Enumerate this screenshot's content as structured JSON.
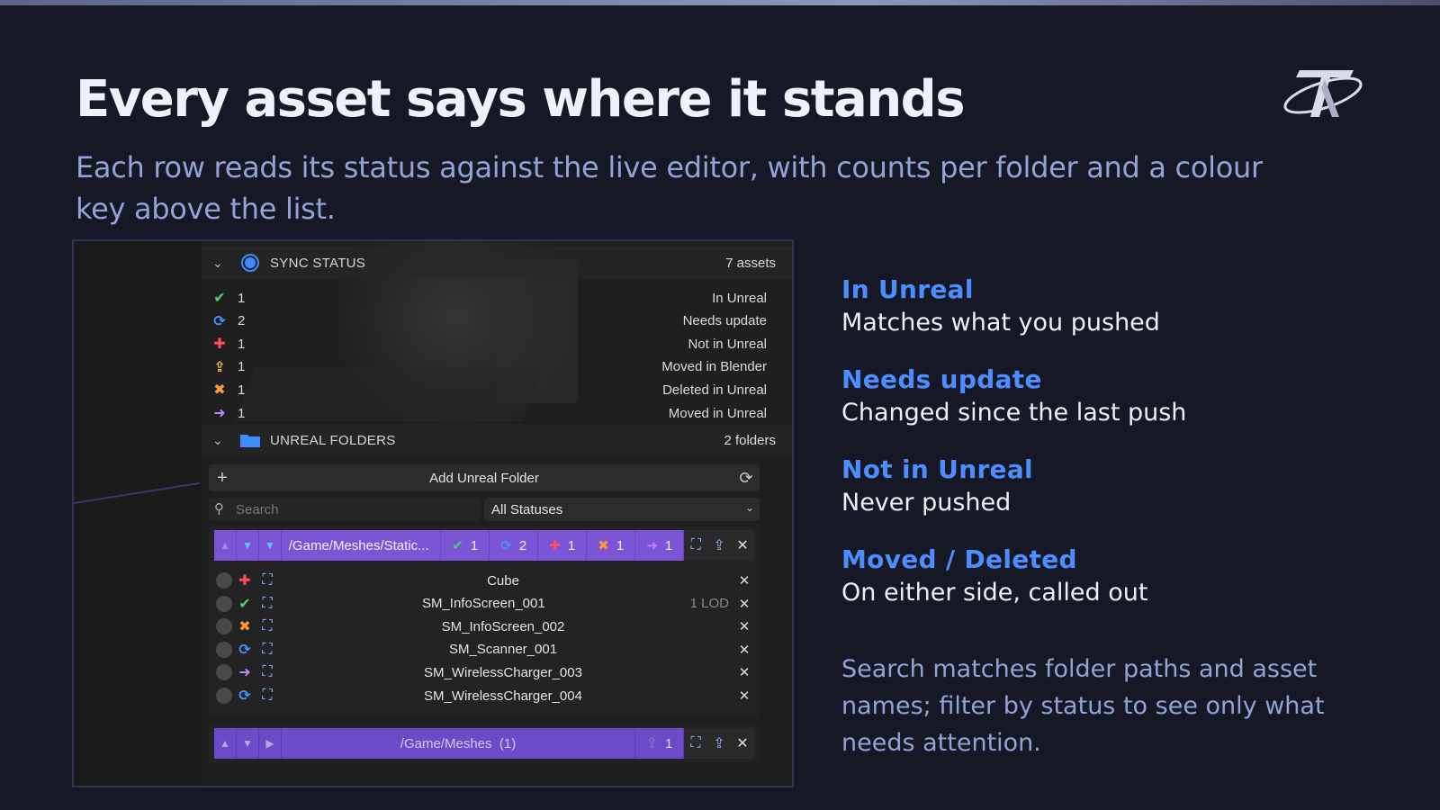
{
  "slide": {
    "title": "Every asset says where it stands",
    "subtitle": "Each row reads its status against the live editor, with counts per folder and a colour key above the list."
  },
  "panel": {
    "sync_status": {
      "label": "SYNC STATUS",
      "count": "7 assets",
      "rows": [
        {
          "icon": "check-icon",
          "glyph": "✔",
          "color": "#4bd36a",
          "count": "1",
          "label": "In Unreal"
        },
        {
          "icon": "refresh-icon",
          "glyph": "⟳",
          "color": "#4a90ff",
          "count": "2",
          "label": "Needs update"
        },
        {
          "icon": "plus-icon",
          "glyph": "✚",
          "color": "#ff4f5e",
          "count": "1",
          "label": "Not in Unreal"
        },
        {
          "icon": "upload-icon",
          "glyph": "⇪",
          "color": "#f1c24b",
          "count": "1",
          "label": "Moved in Blender"
        },
        {
          "icon": "cross-icon",
          "glyph": "✖",
          "color": "#ff9a2e",
          "count": "1",
          "label": "Deleted in Unreal"
        },
        {
          "icon": "arrow-right-icon",
          "glyph": "➜",
          "color": "#c084ff",
          "count": "1",
          "label": "Moved in Unreal"
        }
      ]
    },
    "unreal_folders": {
      "label": "UNREAL FOLDERS",
      "count": "2 folders",
      "add_label": "Add Unreal Folder",
      "search_placeholder": "Search",
      "status_filter": "All Statuses",
      "folder1": {
        "path": "/Game/Meshes/Static...",
        "badges": [
          {
            "glyph": "✔",
            "color": "#4bd36a",
            "count": "1"
          },
          {
            "glyph": "⟳",
            "color": "#4a90ff",
            "count": "2"
          },
          {
            "glyph": "✚",
            "color": "#ff4f5e",
            "count": "1"
          },
          {
            "glyph": "✖",
            "color": "#ff9a2e",
            "count": "1"
          },
          {
            "glyph": "➜",
            "color": "#c084ff",
            "count": "1"
          }
        ],
        "assets": [
          {
            "name": "Cube",
            "glyph": "✚",
            "color": "#ff4f5e",
            "lod": ""
          },
          {
            "name": "SM_InfoScreen_001",
            "glyph": "✔",
            "color": "#4bd36a",
            "lod": "1 LOD"
          },
          {
            "name": "SM_InfoScreen_002",
            "glyph": "✖",
            "color": "#ff9a2e",
            "lod": ""
          },
          {
            "name": "SM_Scanner_001",
            "glyph": "⟳",
            "color": "#4a90ff",
            "lod": ""
          },
          {
            "name": "SM_WirelessCharger_003",
            "glyph": "➜",
            "color": "#c084ff",
            "lod": ""
          },
          {
            "name": "SM_WirelessCharger_004",
            "glyph": "⟳",
            "color": "#4a90ff",
            "lod": ""
          }
        ]
      },
      "folder2": {
        "path": "/Game/Meshes",
        "path_count": "(1)",
        "badge_count": "1"
      }
    }
  },
  "legend": [
    {
      "title": "In Unreal",
      "desc": "Matches what you pushed"
    },
    {
      "title": "Needs update",
      "desc": "Changed since the last push"
    },
    {
      "title": "Not in Unreal",
      "desc": "Never pushed"
    },
    {
      "title": "Moved / Deleted",
      "desc": "On either side, called out"
    }
  ],
  "note": "Search matches folder paths and asset names; filter by status to see only what needs attention.",
  "colors": {
    "accent": "#4c8dff",
    "folder_bar": "#7b55d6",
    "background": "#161826"
  }
}
